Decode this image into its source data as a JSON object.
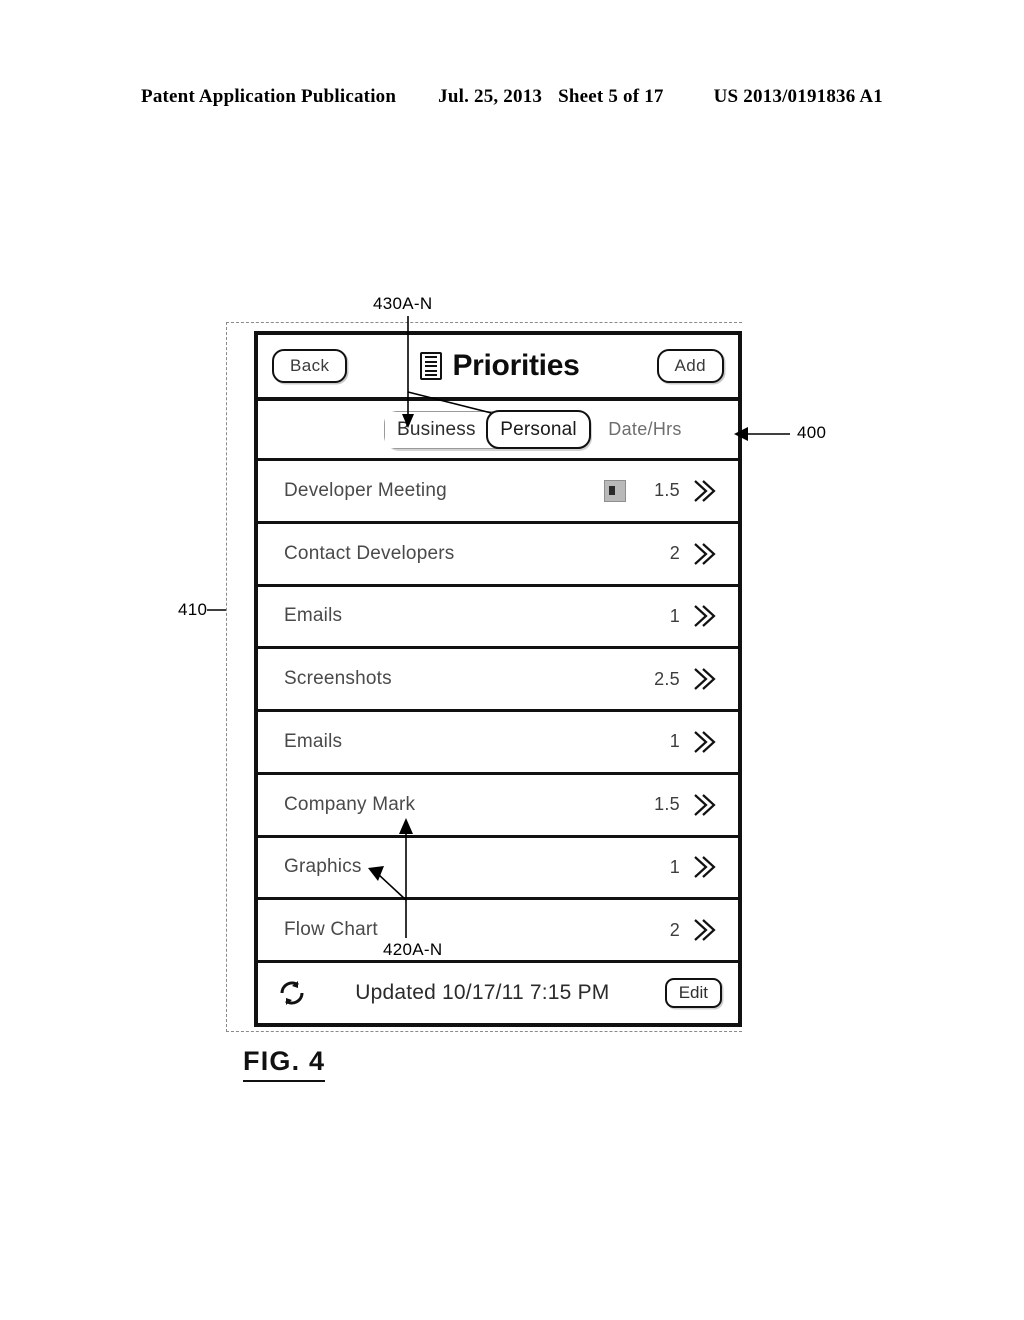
{
  "patent_header": {
    "publication": "Patent Application Publication",
    "date": "Jul. 25, 2013",
    "sheet": "Sheet 5 of 17",
    "number": "US 2013/0191836 A1"
  },
  "figure": {
    "caption": "FIG. 4",
    "callouts": [
      {
        "id": "430A-N",
        "label": "430A-N"
      },
      {
        "id": "400",
        "label": "400"
      },
      {
        "id": "410",
        "label": "410"
      },
      {
        "id": "420A-N",
        "label": "420A-N"
      }
    ]
  },
  "screen": {
    "navbar": {
      "back_label": "Back",
      "title": "Priorities",
      "title_icon": "list-document-icon",
      "add_label": "Add"
    },
    "filterbar": {
      "segments": [
        {
          "label": "Business",
          "selected": false
        },
        {
          "label": "Personal",
          "selected": true
        }
      ],
      "column_header": "Date/Hrs"
    },
    "tasks": [
      {
        "title": "Developer Meeting",
        "hours": "1.5",
        "has_badge": true
      },
      {
        "title": "Contact Developers",
        "hours": "2",
        "has_badge": false
      },
      {
        "title": "Emails",
        "hours": "1",
        "has_badge": false
      },
      {
        "title": "Screenshots",
        "hours": "2.5",
        "has_badge": false
      },
      {
        "title": "Emails",
        "hours": "1",
        "has_badge": false
      },
      {
        "title": "Company Mark",
        "hours": "1.5",
        "has_badge": false
      },
      {
        "title": "Graphics",
        "hours": "1",
        "has_badge": false
      },
      {
        "title": "Flow Chart",
        "hours": "2",
        "has_badge": false
      }
    ],
    "footer": {
      "refresh_icon": "refresh-sync-icon",
      "status": "Updated 10/17/11 7:15 PM",
      "edit_label": "Edit"
    }
  }
}
